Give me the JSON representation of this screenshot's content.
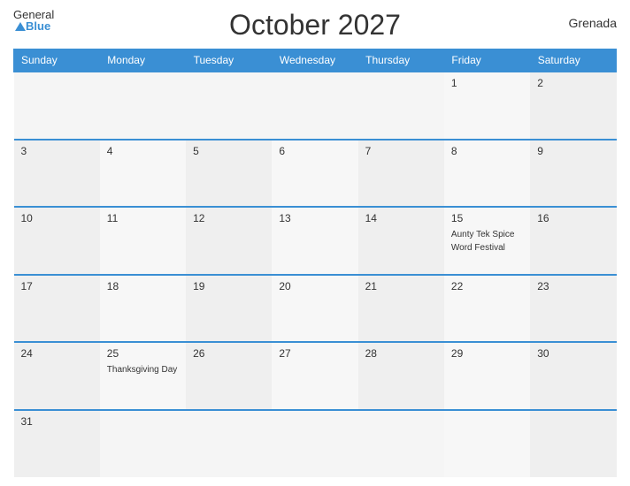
{
  "header": {
    "title": "October 2027",
    "country": "Grenada",
    "logo_general": "General",
    "logo_blue": "Blue"
  },
  "weekdays": [
    "Sunday",
    "Monday",
    "Tuesday",
    "Wednesday",
    "Thursday",
    "Friday",
    "Saturday"
  ],
  "weeks": [
    [
      {
        "day": "",
        "event": ""
      },
      {
        "day": "",
        "event": ""
      },
      {
        "day": "",
        "event": ""
      },
      {
        "day": "",
        "event": ""
      },
      {
        "day": "",
        "event": ""
      },
      {
        "day": "1",
        "event": ""
      },
      {
        "day": "2",
        "event": ""
      }
    ],
    [
      {
        "day": "3",
        "event": ""
      },
      {
        "day": "4",
        "event": ""
      },
      {
        "day": "5",
        "event": ""
      },
      {
        "day": "6",
        "event": ""
      },
      {
        "day": "7",
        "event": ""
      },
      {
        "day": "8",
        "event": ""
      },
      {
        "day": "9",
        "event": ""
      }
    ],
    [
      {
        "day": "10",
        "event": ""
      },
      {
        "day": "11",
        "event": ""
      },
      {
        "day": "12",
        "event": ""
      },
      {
        "day": "13",
        "event": ""
      },
      {
        "day": "14",
        "event": ""
      },
      {
        "day": "15",
        "event": "Aunty Tek Spice Word Festival"
      },
      {
        "day": "16",
        "event": ""
      }
    ],
    [
      {
        "day": "17",
        "event": ""
      },
      {
        "day": "18",
        "event": ""
      },
      {
        "day": "19",
        "event": ""
      },
      {
        "day": "20",
        "event": ""
      },
      {
        "day": "21",
        "event": ""
      },
      {
        "day": "22",
        "event": ""
      },
      {
        "day": "23",
        "event": ""
      }
    ],
    [
      {
        "day": "24",
        "event": ""
      },
      {
        "day": "25",
        "event": "Thanksgiving Day"
      },
      {
        "day": "26",
        "event": ""
      },
      {
        "day": "27",
        "event": ""
      },
      {
        "day": "28",
        "event": ""
      },
      {
        "day": "29",
        "event": ""
      },
      {
        "day": "30",
        "event": ""
      }
    ],
    [
      {
        "day": "31",
        "event": ""
      },
      {
        "day": "",
        "event": ""
      },
      {
        "day": "",
        "event": ""
      },
      {
        "day": "",
        "event": ""
      },
      {
        "day": "",
        "event": ""
      },
      {
        "day": "",
        "event": ""
      },
      {
        "day": "",
        "event": ""
      }
    ]
  ]
}
